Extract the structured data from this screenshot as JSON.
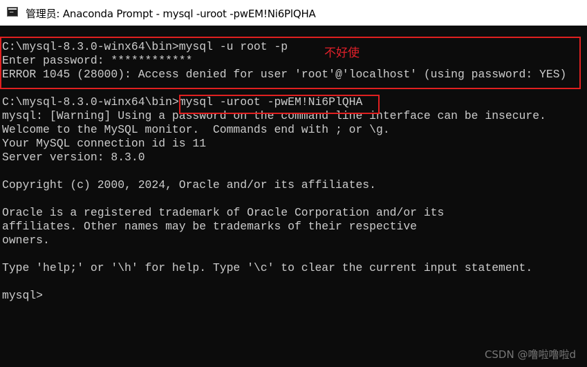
{
  "window": {
    "title": "管理员: Anaconda Prompt - mysql  -uroot -pwEM!Ni6PlQHA"
  },
  "console": {
    "lines": [
      "C:\\mysql-8.3.0-winx64\\bin>mysql -u root -p",
      "Enter password: ************",
      "ERROR 1045 (28000): Access denied for user 'root'@'localhost' (using password: YES)",
      "",
      "C:\\mysql-8.3.0-winx64\\bin>mysql -uroot -pwEM!Ni6PlQHA",
      "mysql: [Warning] Using a password on the command line interface can be insecure.",
      "Welcome to the MySQL monitor.  Commands end with ; or \\g.",
      "Your MySQL connection id is 11",
      "Server version: 8.3.0",
      "",
      "Copyright (c) 2000, 2024, Oracle and/or its affiliates.",
      "",
      "Oracle is a registered trademark of Oracle Corporation and/or its",
      "affiliates. Other names may be trademarks of their respective",
      "owners.",
      "",
      "Type 'help;' or '\\h' for help. Type '\\c' to clear the current input statement.",
      "",
      "mysql>"
    ],
    "text_color": "#cccccc",
    "background": "#0c0c0c"
  },
  "annotation": {
    "note": "不好使",
    "color": "#e0202a"
  },
  "watermark": "CSDN @噜啦噜啦d"
}
